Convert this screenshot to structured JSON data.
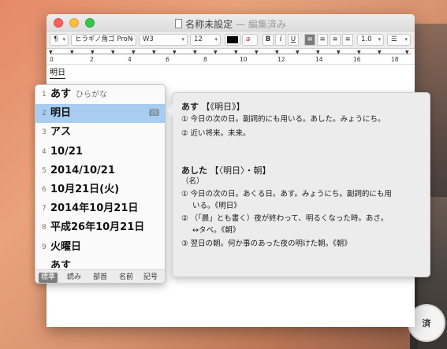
{
  "window": {
    "title": "名称未設定",
    "state": "— 編集済み"
  },
  "toolbar": {
    "paragraph": "¶",
    "font": "ヒラギノ角ゴ ProN",
    "weight": "W3",
    "size": "12",
    "bold": "B",
    "italic": "I",
    "underline": "U",
    "line_spacing": "1.0",
    "list": "☰"
  },
  "ruler": {
    "numbers": [
      "0",
      "2",
      "4",
      "6",
      "8",
      "10",
      "12",
      "14",
      "16",
      "18"
    ]
  },
  "document": {
    "text": "明日"
  },
  "candidates": {
    "items": [
      {
        "num": "1",
        "text": "あす",
        "sub": "ひらがな"
      },
      {
        "num": "2",
        "text": "明日"
      },
      {
        "num": "3",
        "text": "アス"
      },
      {
        "num": "4",
        "text": "10/21"
      },
      {
        "num": "5",
        "text": "2014/10/21"
      },
      {
        "num": "6",
        "text": "10月21日(火)"
      },
      {
        "num": "7",
        "text": "2014年10月21日"
      },
      {
        "num": "8",
        "text": "平成26年10月21日"
      },
      {
        "num": "9",
        "text": "火曜日"
      },
      {
        "num": "",
        "text": "あす"
      }
    ],
    "selected_index": 1,
    "tabs": [
      "標準",
      "読み",
      "部首",
      "名前",
      "記号"
    ]
  },
  "dictionary": {
    "entry1": {
      "head": "あす",
      "kanji": "【《明日》】",
      "lines": [
        "① 今日の次の日。副詞的にも用いる。あした。みょうにち。",
        "② 近い将来。未来。"
      ]
    },
    "entry2": {
      "head": "あした",
      "kanji": "【〈明日〉・朝】",
      "pos": "（名）",
      "lines": [
        "① 今日の次の日。あくる日。あす。みょうにち。副詞的にも用",
        "いる。《明日》",
        "② （「晨」とも書く）夜が終わって、明るくなった時。あさ。",
        "↔タベ。《朝》",
        "③ 翌日の朝。何か事のあった夜の明けた朝。《朝》"
      ]
    }
  },
  "logo": {
    "text": "済"
  }
}
